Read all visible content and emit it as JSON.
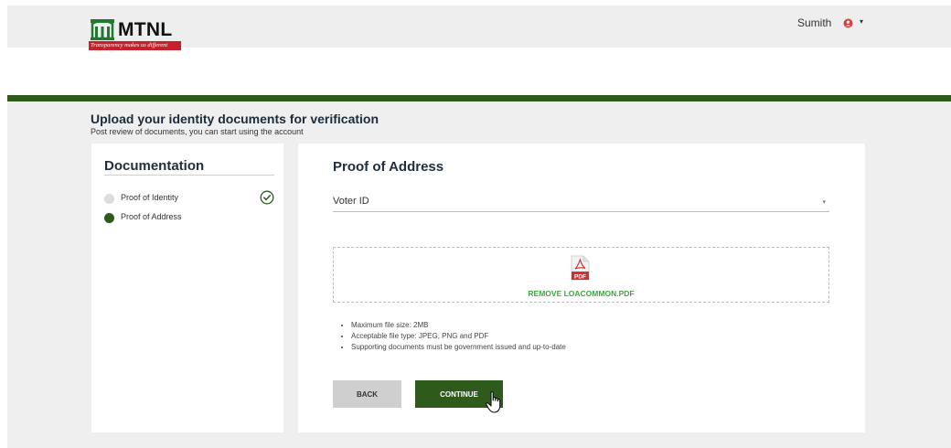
{
  "header": {
    "logo_text": "MTNL",
    "logo_tagline": "Transparency makes us different",
    "user_name": "Sumith",
    "user_caret": "▾"
  },
  "page": {
    "title": "Upload your identity documents for verification",
    "subtitle": "Post review of documents, you can start using the account"
  },
  "sidebar": {
    "heading": "Documentation",
    "steps": [
      {
        "label": "Proof of Identity",
        "status": "completed"
      },
      {
        "label": "Proof of Address",
        "status": "active"
      }
    ]
  },
  "main": {
    "section_title": "Proof of Address",
    "document_type": {
      "selected": "Voter ID",
      "caret": "▾"
    },
    "upload": {
      "remove_label": "REMOVE LOACOMMON.PDF",
      "file_icon": "pdf-icon"
    },
    "rules": [
      "Maximum file size: 2MB",
      "Acceptable file type: JPEG, PNG and PDF",
      "Supporting documents must be government issued and up-to-date"
    ],
    "back_label": "BACK",
    "continue_label": "CONTINUE"
  },
  "colors": {
    "brand_green": "#2e5a1c",
    "link_green": "#3da83d",
    "brand_red": "#c8202a"
  }
}
